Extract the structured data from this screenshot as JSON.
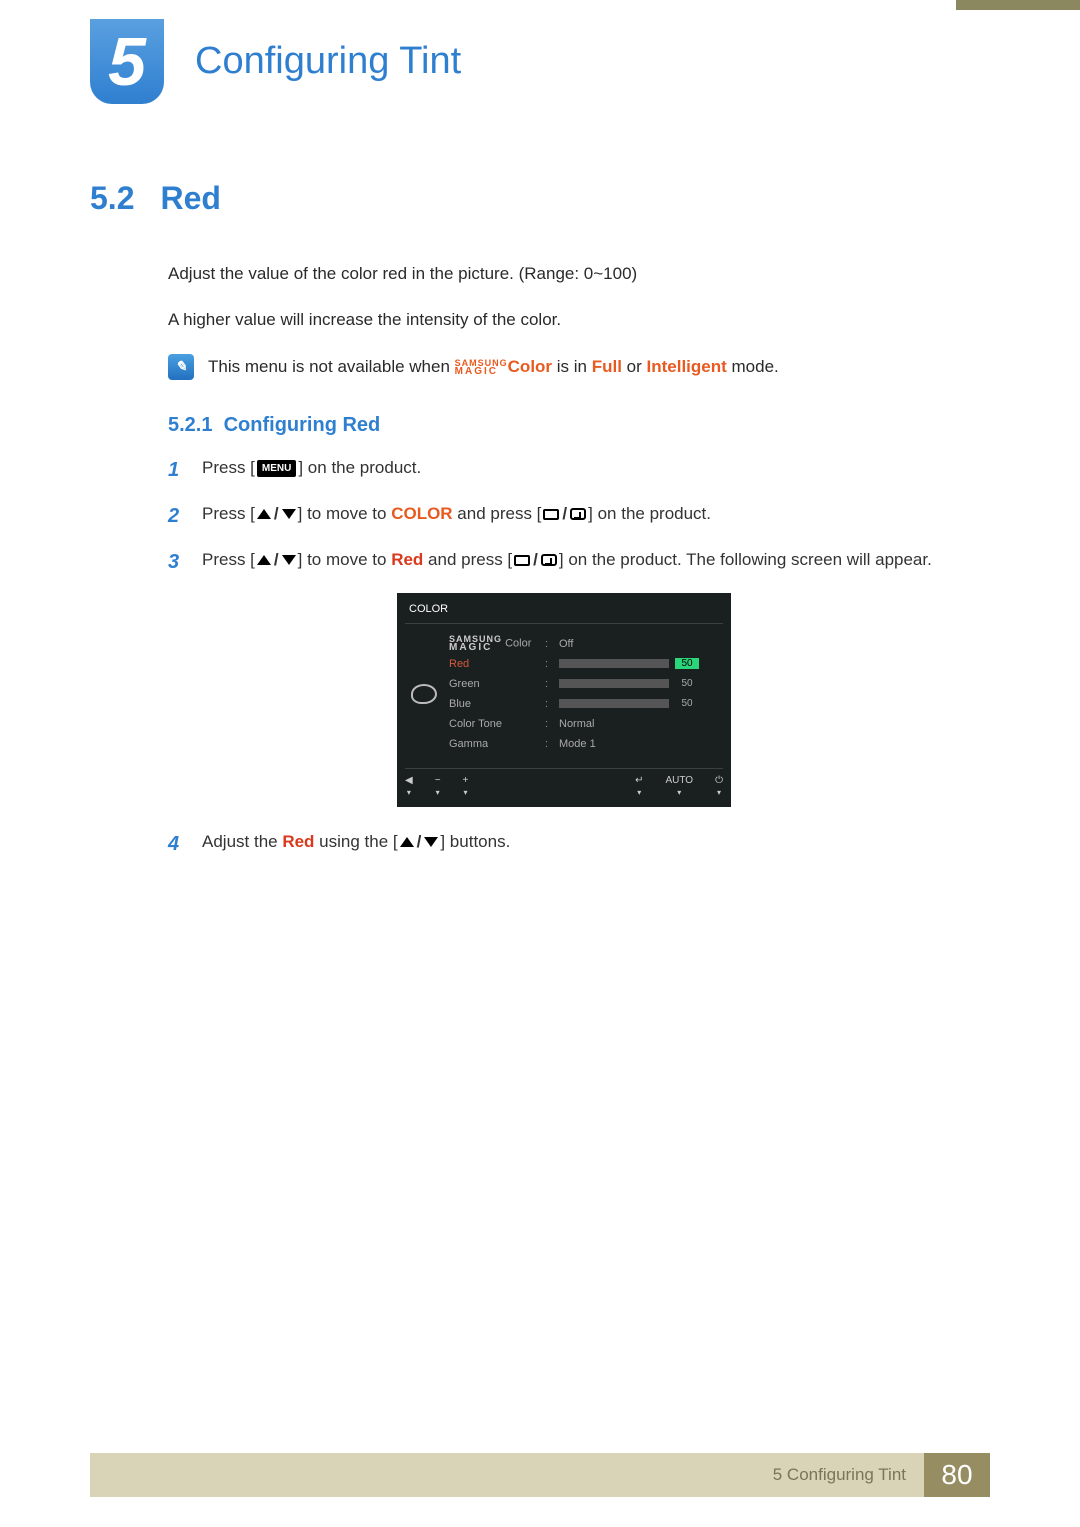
{
  "chapter": {
    "number": "5",
    "title": "Configuring Tint"
  },
  "section": {
    "number": "5.2",
    "title": "Red"
  },
  "intro": {
    "line1": "Adjust the value of the color red in the picture. (Range: 0~100)",
    "line2": "A higher value will increase the intensity of the color."
  },
  "note": {
    "prefix": "This menu is not available when ",
    "magic_top": "SAMSUNG",
    "magic_bottom": "MAGIC",
    "color_word": "Color",
    "middle": " is in ",
    "full": "Full",
    "or": " or ",
    "intelligent": "Intelligent",
    "suffix": " mode."
  },
  "subsection": {
    "number": "5.2.1",
    "title": "Configuring Red"
  },
  "steps": {
    "s1": {
      "num": "1",
      "a": "Press [",
      "menu": "MENU",
      "b": "] on the product."
    },
    "s2": {
      "num": "2",
      "a": "Press [",
      "b": "] to move to ",
      "color": "COLOR",
      "c": " and press [",
      "d": "] on the product."
    },
    "s3": {
      "num": "3",
      "a": "Press [",
      "b": "] to move to ",
      "red": "Red",
      "c": " and press [",
      "d": "] on the product. The following screen will appear."
    },
    "s4": {
      "num": "4",
      "a": "Adjust the ",
      "red": "Red",
      "b": " using the [",
      "c": "] buttons."
    }
  },
  "osd": {
    "title": "COLOR",
    "rows": {
      "magic": {
        "top": "SAMSUNG",
        "bot": "MAGIC",
        "suffix": " Color",
        "value": "Off"
      },
      "red": {
        "label": "Red",
        "value": "50"
      },
      "green": {
        "label": "Green",
        "value": "50"
      },
      "blue": {
        "label": "Blue",
        "value": "50"
      },
      "tone": {
        "label": "Color Tone",
        "value": "Normal"
      },
      "gamma": {
        "label": "Gamma",
        "value": "Mode 1"
      }
    },
    "bottom": {
      "back": "◀",
      "minus": "−",
      "plus": "+",
      "enter": "↵",
      "auto": "AUTO",
      "power": "⏻",
      "arrow": "▾"
    }
  },
  "footer": {
    "label": "5 Configuring Tint",
    "page": "80"
  }
}
